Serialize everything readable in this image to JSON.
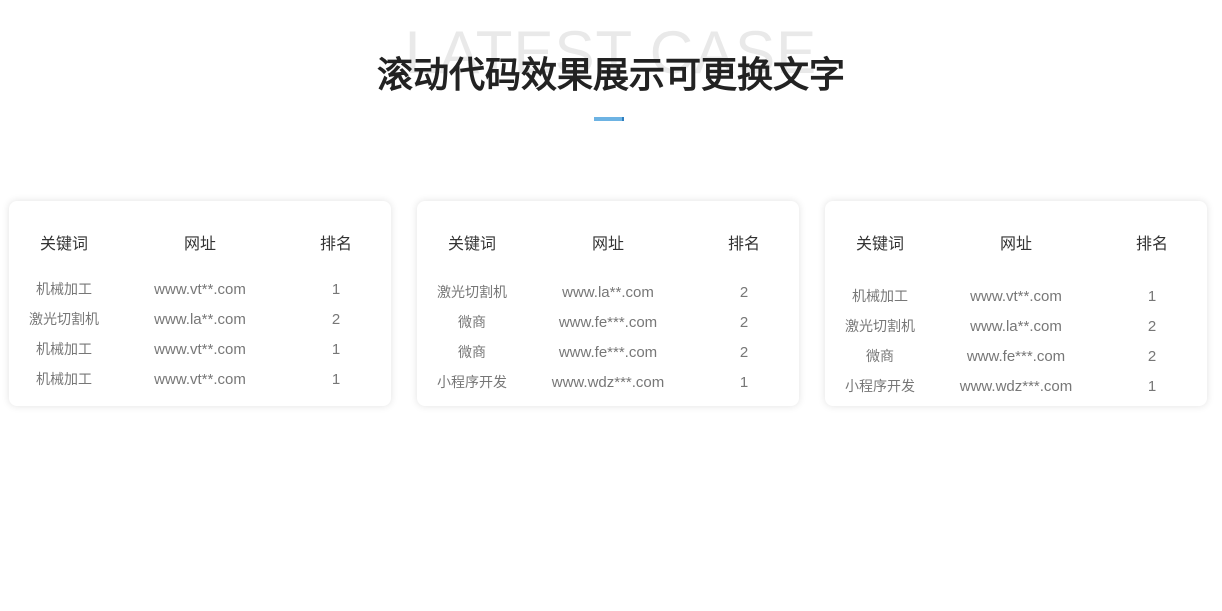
{
  "header": {
    "bg_word": "LATEST CASE",
    "title": "滚动代码效果展示可更换文字"
  },
  "columns": {
    "keyword": "关键词",
    "url": "网址",
    "rank": "排名"
  },
  "cards": [
    {
      "rows": [
        {
          "keyword": "机械加工",
          "url": "www.vt**.com",
          "rank": "1"
        },
        {
          "keyword": "激光切割机",
          "url": "www.la**.com",
          "rank": "2"
        },
        {
          "keyword": "机械加工",
          "url": "www.vt**.com",
          "rank": "1"
        },
        {
          "keyword": "机械加工",
          "url": "www.vt**.com",
          "rank": "1"
        }
      ]
    },
    {
      "rows": [
        {
          "keyword": "激光切割机",
          "url": "www.la**.com",
          "rank": "2"
        },
        {
          "keyword": "微商",
          "url": "www.fe***.com",
          "rank": "2"
        },
        {
          "keyword": "微商",
          "url": "www.fe***.com",
          "rank": "2"
        },
        {
          "keyword": "小程序开发",
          "url": "www.wdz***.com",
          "rank": "1"
        }
      ]
    },
    {
      "rows": [
        {
          "keyword": "机械加工",
          "url": "www.vt**.com",
          "rank": "1"
        },
        {
          "keyword": "激光切割机",
          "url": "www.la**.com",
          "rank": "2"
        },
        {
          "keyword": "微商",
          "url": "www.fe***.com",
          "rank": "2"
        },
        {
          "keyword": "小程序开发",
          "url": "www.wdz***.com",
          "rank": "1"
        }
      ]
    }
  ]
}
